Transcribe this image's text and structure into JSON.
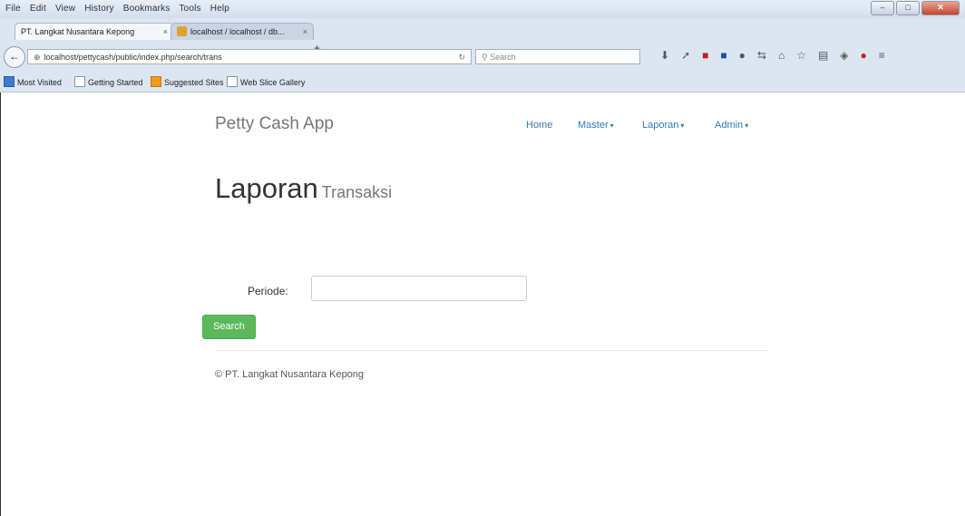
{
  "browser": {
    "menu": [
      "File",
      "Edit",
      "View",
      "History",
      "Bookmarks",
      "Tools",
      "Help"
    ],
    "tabs": [
      {
        "title": "PT. Langkat Nusantara Kepong"
      },
      {
        "title": "localhost / localhost / db..."
      }
    ],
    "url": "localhost/pettycash/public/index.php/search/trans",
    "search_placeholder": "Search",
    "bookmarks": [
      "Most Visited",
      "Getting Started",
      "Suggested Sites",
      "Web Slice Gallery"
    ]
  },
  "app": {
    "brand": "Petty Cash App",
    "nav": [
      {
        "label": "Home"
      },
      {
        "label": "Master"
      },
      {
        "label": "Laporan"
      },
      {
        "label": "Admin"
      }
    ],
    "heading": "Laporan",
    "subheading": "Transaksi",
    "form": {
      "periode_label": "Periode:",
      "periode_value": "",
      "search_button": "Search"
    },
    "footer": "© PT. Langkat Nusantara Kepong"
  },
  "colors": {
    "link": "#337ab7",
    "button": "#5cb85c"
  }
}
